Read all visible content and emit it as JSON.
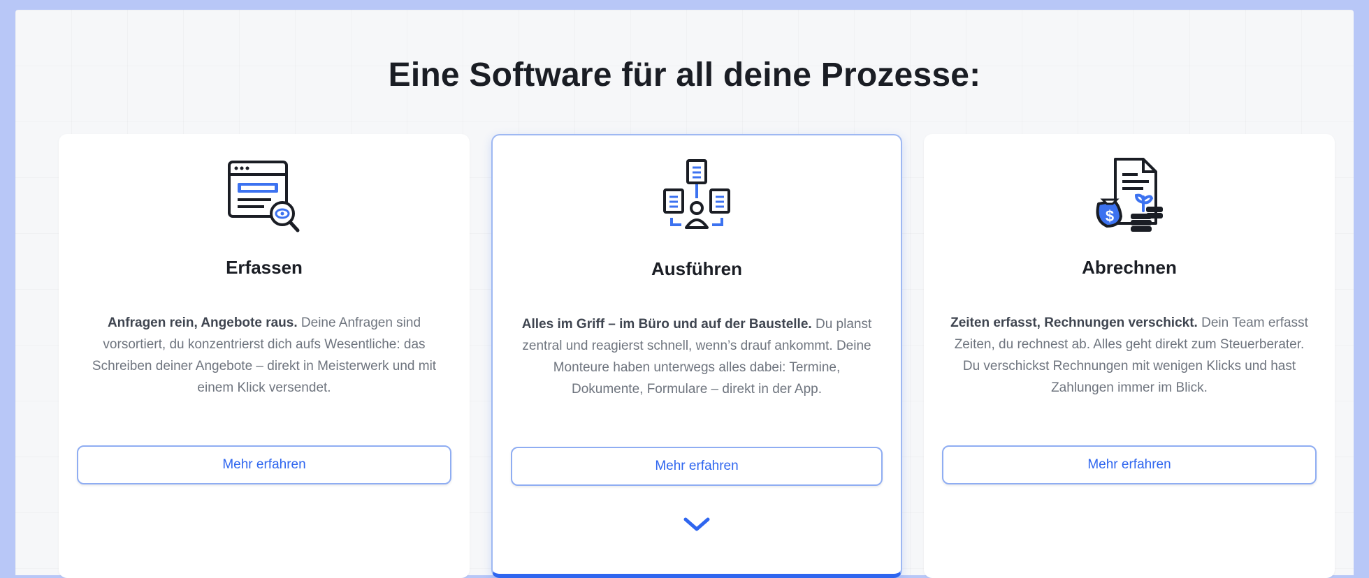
{
  "section": {
    "title": "Eine Software für all deine Prozesse:"
  },
  "cards": [
    {
      "icon": "browser-search-icon",
      "title": "Erfassen",
      "lead": "Anfragen rein, Angebote raus.",
      "body": " Deine Anfragen sind vorsortiert, du konzentrierst dich aufs Wesentliche: das Schreiben deiner Angebote – direkt in Meisterwerk und mit einem Klick versendet.",
      "button": "Mehr erfahren"
    },
    {
      "icon": "team-documents-icon",
      "title": "Ausführen",
      "lead": "Alles im Griff – im Büro und auf der Baustelle.",
      "body": " Du planst zentral und reagierst schnell, wenn’s drauf ankommt. Deine Monteure haben unterwegs alles dabei: Termine, Dokumente, Formulare – direkt in der App.",
      "button": "Mehr erfahren"
    },
    {
      "icon": "invoice-money-icon",
      "title": "Abrechnen",
      "lead": "Zeiten erfasst, Rechnungen verschickt.",
      "body": " Dein Team erfasst Zeiten, du rechnest ab. Alles geht direkt zum Steuerberater. Du verschickst Rechnungen mit wenigen Klicks und hast Zahlungen immer im Blick.",
      "button": "Mehr erfahren"
    }
  ],
  "expand_icon": "chevron-down-icon",
  "colors": {
    "accent": "#2f66ef",
    "icon_blue": "#3c72f0",
    "text_dark": "#1a1d24"
  }
}
